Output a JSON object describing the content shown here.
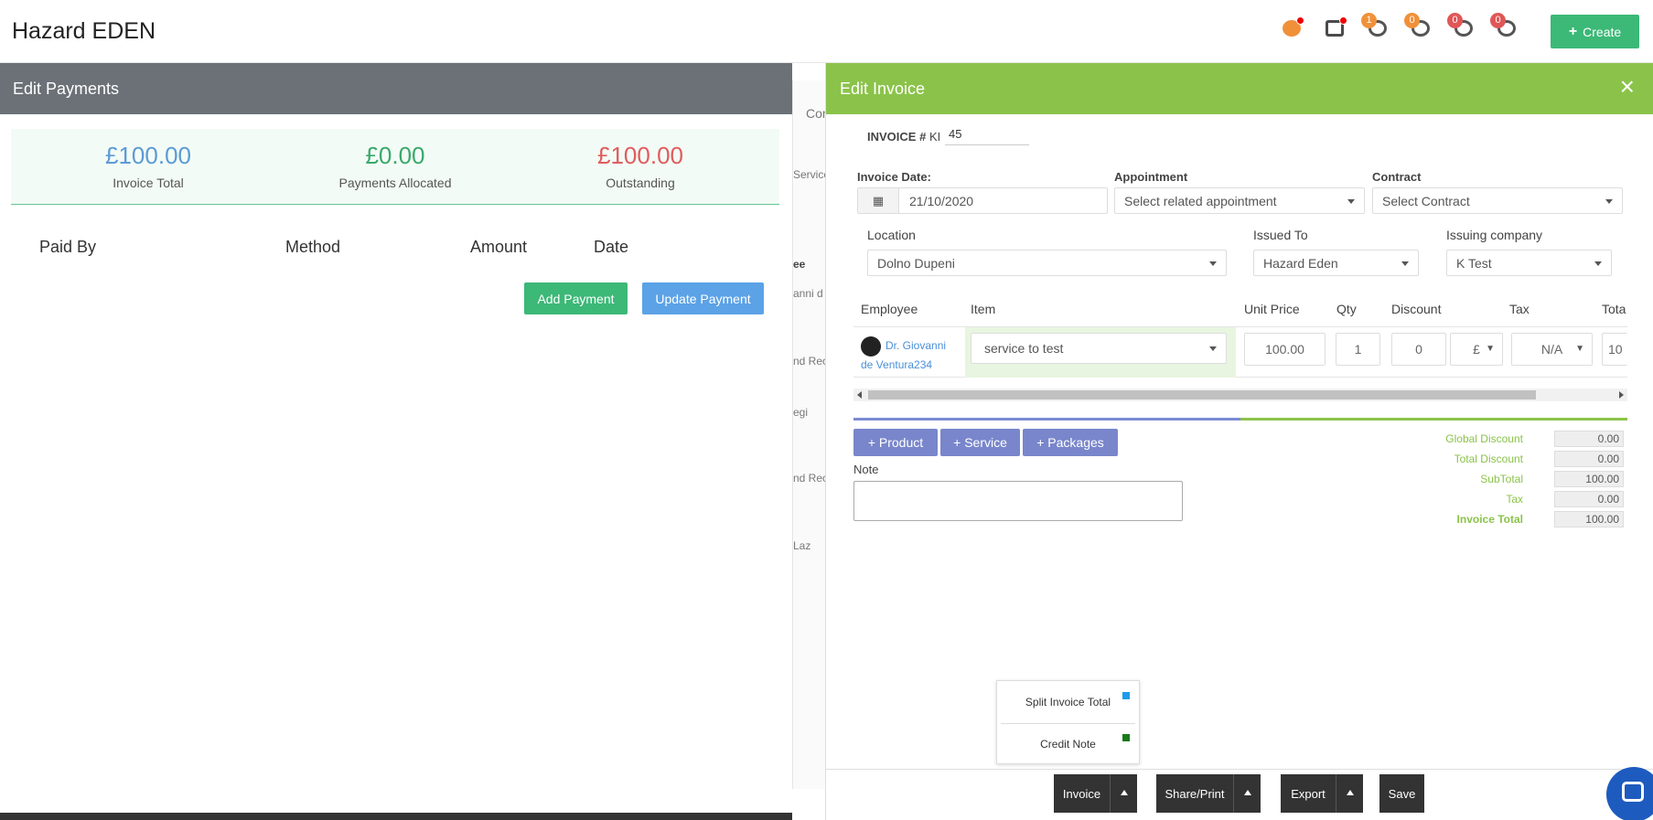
{
  "app": {
    "title": "Hazard EDEN",
    "create_label": "Create"
  },
  "top_icons": [
    {
      "name": "timer-icon",
      "badge": "",
      "dot": true
    },
    {
      "name": "medical-kit-icon",
      "badge": "",
      "dot": true
    },
    {
      "name": "target-icon",
      "badge": "1",
      "dot": false
    },
    {
      "name": "pencil-icon",
      "badge": "0",
      "dot": false
    },
    {
      "name": "warning-icon",
      "badge": "0",
      "dot": false
    },
    {
      "name": "heart-icon",
      "badge": "0",
      "dot": false
    }
  ],
  "payments": {
    "title": "Edit Payments",
    "invoice_total": "£100.00",
    "invoice_total_label": "Invoice Total",
    "allocated": "£0.00",
    "allocated_label": "Payments Allocated",
    "outstanding": "£100.00",
    "outstanding_label": "Outstanding",
    "columns": [
      "Paid By",
      "Method",
      "Amount",
      "Date"
    ],
    "add_payment": "Add Payment",
    "update_payment": "Update Payment"
  },
  "background": {
    "fragments": [
      "Cor",
      "Service",
      "ee",
      "anni d",
      "nd Rec",
      "egi",
      "nd Rec",
      "Laz"
    ]
  },
  "invoice": {
    "title": "Edit Invoice",
    "number_label": "INVOICE #",
    "prefix": "KI",
    "number": "45",
    "date_label": "Invoice Date:",
    "date": "21/10/2020",
    "appointment_label": "Appointment",
    "appointment_placeholder": "Select related appointment",
    "contract_label": "Contract",
    "contract_placeholder": "Select Contract",
    "location_label": "Location",
    "location": "Dolno Dupeni",
    "issued_to_label": "Issued To",
    "issued_to": "Hazard Eden",
    "issuing_company_label": "Issuing company",
    "issuing_company": "K Test",
    "columns": [
      "Employee",
      "Item",
      "Unit Price",
      "Qty",
      "Discount",
      "Tax",
      "Tota"
    ],
    "row": {
      "employee": "Dr. Giovanni de Ventura234",
      "item": "service to test",
      "unit_price": "100.00",
      "qty": "1",
      "discount": "0",
      "discount_type": "£",
      "tax": "N/A",
      "total": "10"
    },
    "add_product": "+ Product",
    "add_service": "+ Service",
    "add_packages": "+ Packages",
    "note_label": "Note",
    "totals": [
      {
        "label": "Global Discount",
        "value": "0.00"
      },
      {
        "label": "Total Discount",
        "value": "0.00"
      },
      {
        "label": "SubTotal",
        "value": "100.00"
      },
      {
        "label": "Tax",
        "value": "0.00"
      },
      {
        "label": "Invoice Total",
        "value": "100.00"
      }
    ],
    "menu": {
      "split": "Split Invoice Total",
      "credit": "Credit Note",
      "split_color": "#1e9be9",
      "credit_color": "#1a7a1a"
    },
    "footer": {
      "invoice": "Invoice",
      "share": "Share/Print",
      "export": "Export",
      "save": "Save"
    }
  },
  "colors": {
    "green_header": "#8bc34a",
    "gray_header": "#6b7177",
    "primary_green": "#3cb877",
    "primary_blue": "#5ba2e6",
    "indigo": "#7986cb"
  }
}
